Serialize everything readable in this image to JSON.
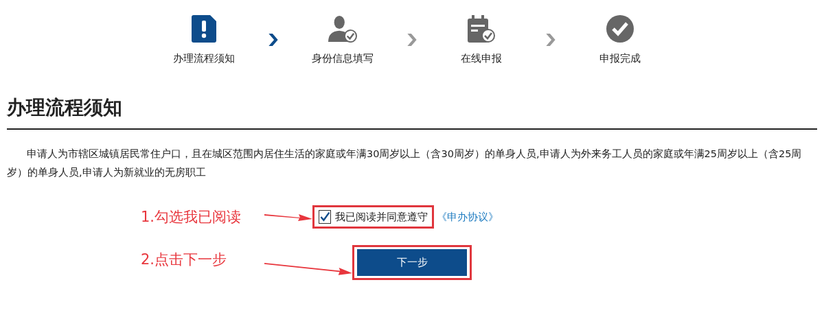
{
  "steps": [
    {
      "kind": "notice",
      "label": "办理流程须知",
      "selected": true
    },
    {
      "kind": "person",
      "label": "身份信息填写",
      "selected": false
    },
    {
      "kind": "calendar",
      "label": "在线申报",
      "selected": false
    },
    {
      "kind": "check",
      "label": "申报完成",
      "selected": false
    }
  ],
  "heading": "办理流程须知",
  "paragraph": "申请人为市辖区城镇居民常住户口，且在城区范围内居住生活的家庭或年满30周岁以上（含30周岁）的单身人员,申请人为外来务工人员的家庭或年满25周岁以上（含25周岁）的单身人员,申请人为新就业的无房职工",
  "agreement": {
    "label": "我已阅读并同意遵守",
    "checked": true,
    "link": "《申办协议》"
  },
  "next_button": "下一步",
  "annotations": [
    {
      "text": "1.勾选我已阅读"
    },
    {
      "text": "2.点击下一步"
    }
  ]
}
